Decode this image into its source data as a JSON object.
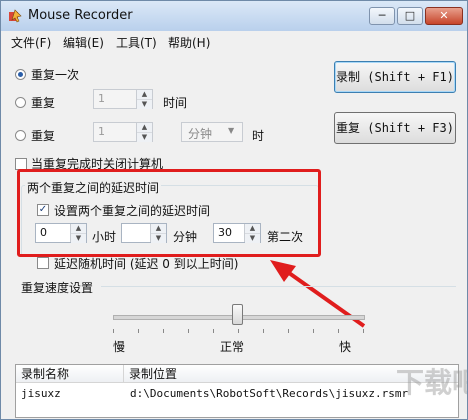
{
  "window": {
    "title": "Mouse Recorder",
    "minimize": "─",
    "maximize": "□",
    "close": "✕",
    "icon": "app-mouse-icon"
  },
  "menu": [
    "文件(F)",
    "编辑(E)",
    "工具(T)",
    "帮助(H)"
  ],
  "repeat": {
    "once_label": "重复一次",
    "times_label": "重复",
    "times_value": "1",
    "times_unit": "时间",
    "duration_label": "重复",
    "duration_value": "1",
    "duration_unit_selected": "分钟",
    "duration_suffix": "时",
    "shutdown_label": "当重复完成时关闭计算机"
  },
  "buttons": {
    "record": "录制 (Shift + F1)",
    "repeat": "重复 (Shift + F3)"
  },
  "delay": {
    "group_title": "两个重复之间的延迟时间",
    "enable_label": "设置两个重复之间的延迟时间",
    "hours_value": "0",
    "hours_label": "小时",
    "minutes_value": "",
    "minutes_label": "分钟",
    "seconds_value": "30",
    "seconds_label": "第二次",
    "random_label": "延迟随机时间 (延迟 0 到以上时间)"
  },
  "speed": {
    "title": "重复速度设置",
    "slow": "慢",
    "normal": "正常",
    "fast": "快",
    "level": 0.5
  },
  "recordings": {
    "columns": [
      "录制名称",
      "录制位置"
    ],
    "rows": [
      {
        "name": "jisuxz",
        "path": "d:\\Documents\\RobotSoft\\Records\\jisuxz.rsmr"
      }
    ]
  },
  "watermark": "下载吧"
}
